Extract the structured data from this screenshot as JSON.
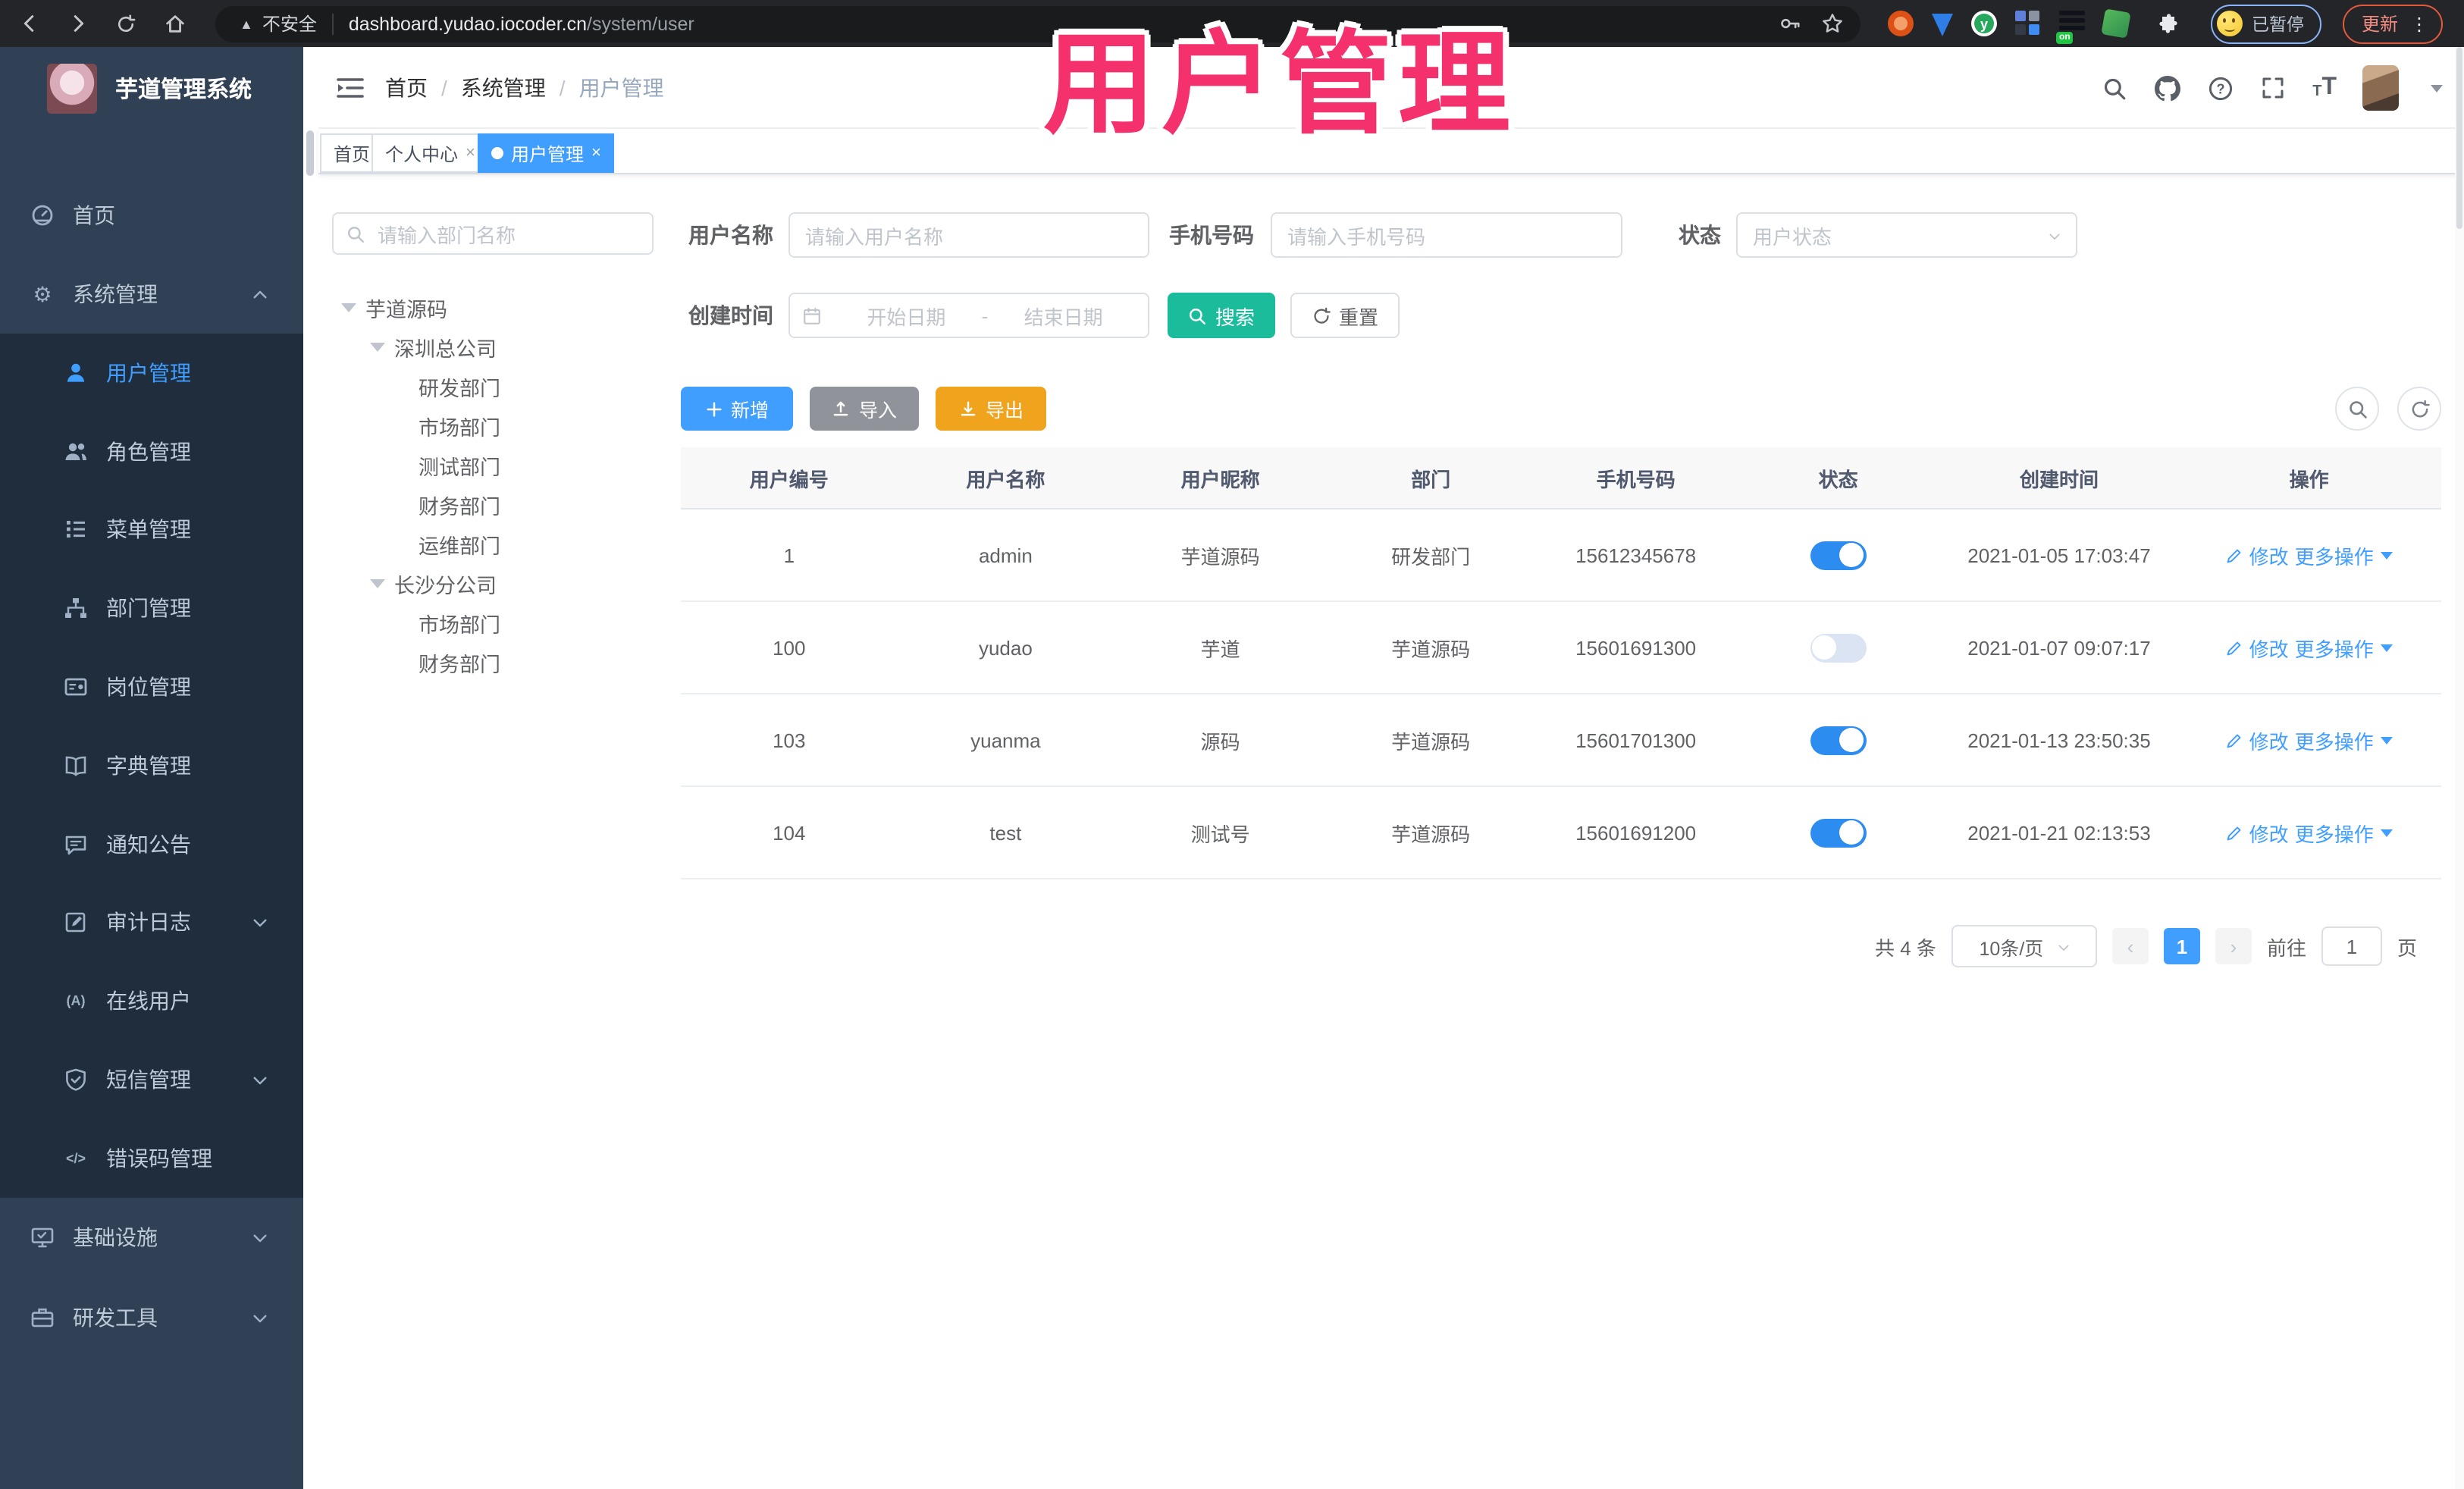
{
  "glyphs": {
    "warning_triangle": "▲",
    "gear": "⚙",
    "online": "(A)",
    "code": "</>",
    "dots": "⋮",
    "close": "×",
    "plus": "+",
    "prev": "‹",
    "next": "›",
    "slash": "/",
    "question": "?",
    "font_small": "T",
    "font_big": "T",
    "y_letter": "y",
    "on_badge": "on"
  },
  "colors": {
    "primary": "#409eff",
    "search_teal": "#1abc9c",
    "import_gray": "#909399",
    "export_orange": "#f0a31c",
    "watermark_pink": "#f5316d",
    "sidebar_bg": "#304156",
    "submenu_bg": "#1f2d3d"
  },
  "browser": {
    "security_label": "不安全",
    "url_host": "dashboard.yudao.iocoder.cn",
    "url_path": "/system/user",
    "profile_badge": "已暂停",
    "update_label": "更新"
  },
  "watermark": {
    "text": "用户管理"
  },
  "sidebar": {
    "title": "芋道管理系统",
    "home_label": "首页",
    "system_label": "系统管理",
    "system_children": [
      {
        "label": "用户管理"
      },
      {
        "label": "角色管理"
      },
      {
        "label": "菜单管理"
      },
      {
        "label": "部门管理"
      },
      {
        "label": "岗位管理"
      },
      {
        "label": "字典管理"
      },
      {
        "label": "通知公告"
      },
      {
        "label": "审计日志"
      },
      {
        "label": "在线用户"
      },
      {
        "label": "短信管理"
      },
      {
        "label": "错误码管理"
      }
    ],
    "infra_label": "基础设施",
    "devtools_label": "研发工具"
  },
  "breadcrumb": {
    "items": [
      "首页",
      "系统管理",
      "用户管理"
    ]
  },
  "tabs": [
    {
      "label": "首页"
    },
    {
      "label": "个人中心"
    },
    {
      "label": "用户管理"
    }
  ],
  "dept": {
    "search_placeholder": "请输入部门名称",
    "nodes": [
      {
        "label": "芋道源码"
      },
      {
        "label": "深圳总公司"
      },
      {
        "label": "研发部门"
      },
      {
        "label": "市场部门"
      },
      {
        "label": "测试部门"
      },
      {
        "label": "财务部门"
      },
      {
        "label": "运维部门"
      },
      {
        "label": "长沙分公司"
      },
      {
        "label": "市场部门"
      },
      {
        "label": "财务部门"
      }
    ]
  },
  "filters": {
    "username_label": "用户名称",
    "username_placeholder": "请输入用户名称",
    "mobile_label": "手机号码",
    "mobile_placeholder": "请输入手机号码",
    "status_label": "状态",
    "status_placeholder": "用户状态",
    "created_label": "创建时间",
    "date_start_placeholder": "开始日期",
    "date_separator": "-",
    "date_end_placeholder": "结束日期",
    "search_label": "搜索",
    "reset_label": "重置"
  },
  "toolbar": {
    "add_label": "新增",
    "import_label": "导入",
    "export_label": "导出"
  },
  "table": {
    "columns": [
      "用户编号",
      "用户名称",
      "用户昵称",
      "部门",
      "手机号码",
      "状态",
      "创建时间",
      "操作"
    ],
    "edit_label": "修改",
    "more_label": "更多操作",
    "rows": [
      {
        "id": "1",
        "username": "admin",
        "nickname": "芋道源码",
        "dept": "研发部门",
        "mobile": "15612345678",
        "status": true,
        "created": "2021-01-05 17:03:47"
      },
      {
        "id": "100",
        "username": "yudao",
        "nickname": "芋道",
        "dept": "芋道源码",
        "mobile": "15601691300",
        "status": false,
        "created": "2021-01-07 09:07:17"
      },
      {
        "id": "103",
        "username": "yuanma",
        "nickname": "源码",
        "dept": "芋道源码",
        "mobile": "15601701300",
        "status": true,
        "created": "2021-01-13 23:50:35"
      },
      {
        "id": "104",
        "username": "test",
        "nickname": "测试号",
        "dept": "芋道源码",
        "mobile": "15601691200",
        "status": true,
        "created": "2021-01-21 02:13:53"
      }
    ]
  },
  "pagination": {
    "total_label": "共 4 条",
    "page_size": "10条/页",
    "current_page": "1",
    "goto_label": "前往",
    "goto_value": "1",
    "page_unit": "页"
  }
}
